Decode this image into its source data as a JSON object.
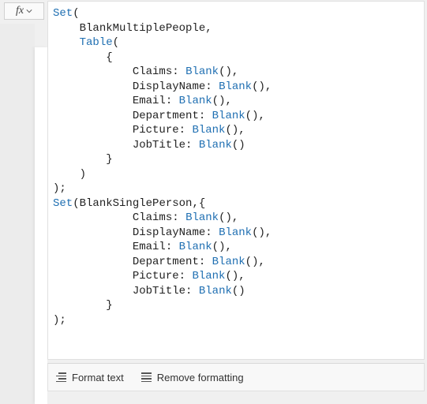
{
  "fx": {
    "label": "fx"
  },
  "code": {
    "set": "Set",
    "table": "Table",
    "blank": "Blank",
    "var1": "BlankMultiplePeople",
    "var2": "BlankSinglePerson",
    "fields": {
      "claims": "Claims",
      "displayName": "DisplayName",
      "email": "Email",
      "department": "Department",
      "picture": "Picture",
      "jobTitle": "JobTitle"
    }
  },
  "toolbar": {
    "format": "Format text",
    "remove": "Remove formatting"
  }
}
